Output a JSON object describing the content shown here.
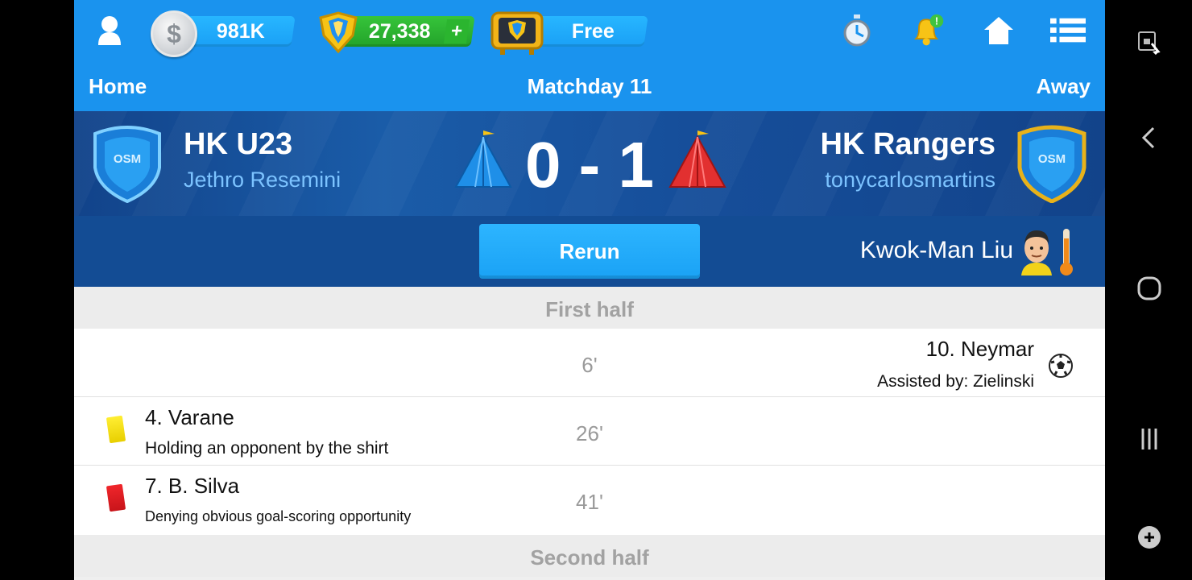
{
  "topbar": {
    "coins": "981K",
    "gems": "27,338",
    "gems_plus": "+",
    "tv_label": "Free",
    "icons": [
      "user-icon",
      "silver-coin-icon",
      "gem-icon",
      "tv-icon",
      "stopwatch-icon",
      "bell-notification-icon",
      "home-icon",
      "menu-list-icon"
    ],
    "notification_badge": "!"
  },
  "header": {
    "home": "Home",
    "matchday": "Matchday 11",
    "away": "Away"
  },
  "match": {
    "home_team": "HK U23",
    "home_manager": "Jethro Resemini",
    "away_team": "HK Rangers",
    "away_manager": "tonycarlosmartins",
    "score": "0 - 1",
    "crest_text": "OSM",
    "home_color": "#1f8fe8",
    "away_color": "#e23030"
  },
  "rerun": {
    "label": "Rerun"
  },
  "referee": {
    "name": "Kwok-Man Liu"
  },
  "timeline": {
    "first_half": "First half",
    "second_half": "Second half",
    "events": [
      {
        "minute": "6'",
        "side": "away",
        "type": "goal",
        "player": "10. Neymar",
        "detail": "Assisted by: Zielinski"
      },
      {
        "minute": "26'",
        "side": "home",
        "type": "yellow-card",
        "player": "4. Varane",
        "detail": "Holding an opponent by the shirt"
      },
      {
        "minute": "41'",
        "side": "home",
        "type": "red-card",
        "player": "7. B. Silva",
        "detail": "Denying obvious goal-scoring opportunity"
      }
    ]
  },
  "system_nav": [
    "screen-lock-icon",
    "back-icon",
    "home-circle-icon",
    "recents-icon",
    "game-tools-icon"
  ]
}
